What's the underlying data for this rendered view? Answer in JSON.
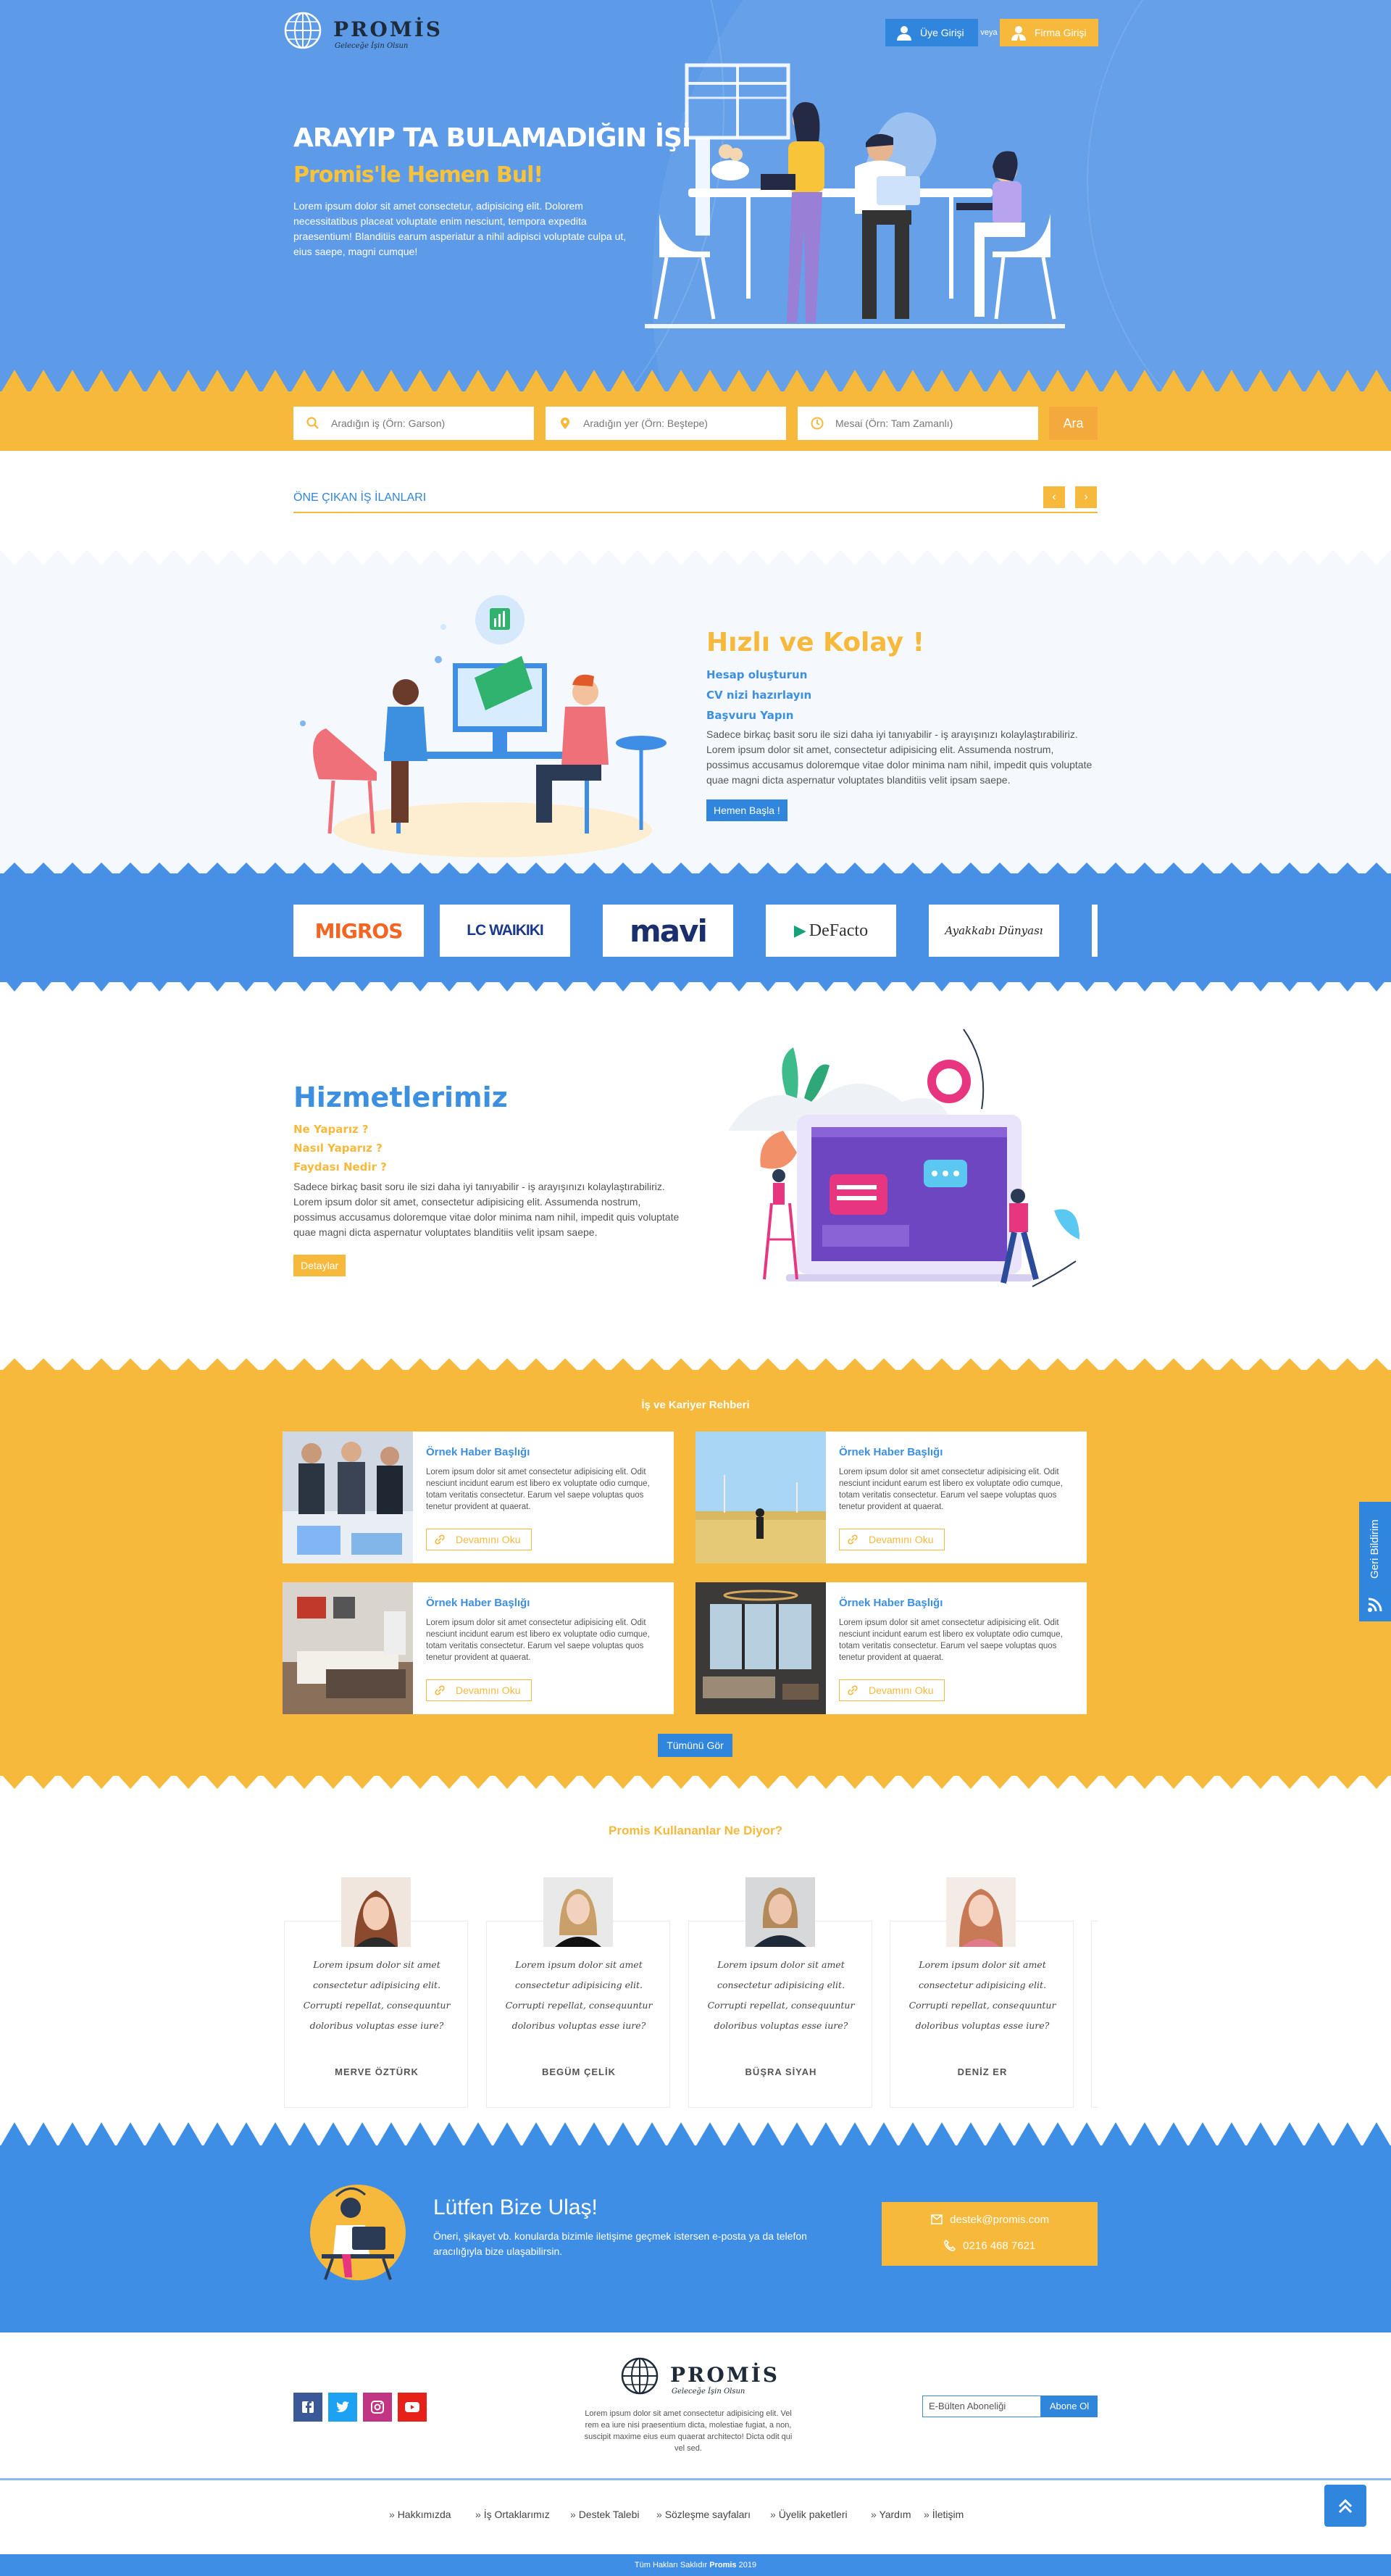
{
  "header": {
    "brand_name": "PROMİS",
    "brand_slogan": "Geleceğe İşin Olsun",
    "member_login": "Üye Girişi",
    "or_label": "veya",
    "company_login": "Firma Girişi"
  },
  "hero": {
    "title": "ARAYIP TA BULAMADIĞIN İŞİ",
    "subtitle": "Promis'le Hemen Bul!",
    "text": "Lorem ipsum dolor sit amet consectetur, adipisicing elit. Dolorem necessitatibus placeat voluptate enim nesciunt, tempora expedita praesentium! Blanditiis earum asperiatur a nihil adipisci voluptate culpa ut, eius saepe, magni cumque!"
  },
  "search": {
    "job_placeholder": "Aradığın iş (Örn: Garson)",
    "place_placeholder": "Aradığın yer (Örn: Beştepe)",
    "shift_placeholder": "Mesai (Örn: Tam Zamanlı)",
    "button": "Ara"
  },
  "featured": {
    "title": "ÖNE ÇIKAN İŞ İLANLARI",
    "prev": "‹",
    "next": "›"
  },
  "quick": {
    "title": "Hızlı ve Kolay !",
    "steps": [
      "Hesap oluşturun",
      "CV nizi hazırlayın",
      "Başvuru Yapın"
    ],
    "text": "Sadece birkaç basit soru ile sizi daha iyi tanıyabilir - iş arayışınızı kolaylaştırabiliriz. Lorem ipsum dolor sit amet, consectetur adipisicing elit. Assumenda nostrum, possimus accusamus doloremque vitae dolor minima nam nihil, impedit quis voluptate quae magni dicta aspernatur voluptates blanditiis velit ipsam saepe.",
    "button": "Hemen Başla !"
  },
  "brands": [
    "MIGROS",
    "LC WAIKIKI",
    "mavi",
    "DeFacto",
    "Ayakkabı Dünyası"
  ],
  "services": {
    "title": "Hizmetlerimiz",
    "items": [
      "Ne Yaparız ?",
      "Nasıl Yaparız ?",
      "Faydası Nedir ?"
    ],
    "text": "Sadece birkaç basit soru ile sizi daha iyi tanıyabilir - iş arayışınızı kolaylaştırabiliriz. Lorem ipsum dolor sit amet, consectetur adipisicing elit. Assumenda nostrum, possimus accusamus doloremque vitae dolor minima nam nihil, impedit quis voluptate quae magni dicta aspernatur voluptates blanditiis velit ipsam saepe.",
    "button": "Detaylar"
  },
  "guide": {
    "title": "İş ve Kariyer Rehberi",
    "cards": [
      {
        "title": "Örnek Haber Başlığı",
        "text": "Lorem ipsum dolor sit amet consectetur adipisicing elit. Odit nesciunt incidunt earum est libero ex voluptate odio cumque, totam veritatis consectetur. Earum vel saepe voluptas quos tenetur provident at quaerat.",
        "more": "Devamını Oku"
      },
      {
        "title": "Örnek Haber Başlığı",
        "text": "Lorem ipsum dolor sit amet consectetur adipisicing elit. Odit nesciunt incidunt earum est libero ex voluptate odio cumque, totam veritatis consectetur. Earum vel saepe voluptas quos tenetur provident at quaerat.",
        "more": "Devamını Oku"
      },
      {
        "title": "Örnek Haber Başlığı",
        "text": "Lorem ipsum dolor sit amet consectetur adipisicing elit. Odit nesciunt incidunt earum est libero ex voluptate odio cumque, totam veritatis consectetur. Earum vel saepe voluptas quos tenetur provident at quaerat.",
        "more": "Devamını Oku"
      },
      {
        "title": "Örnek Haber Başlığı",
        "text": "Lorem ipsum dolor sit amet consectetur adipisicing elit. Odit nesciunt incidunt earum est libero ex voluptate odio cumque, totam veritatis consectetur. Earum vel saepe voluptas quos tenetur provident at quaerat.",
        "more": "Devamını Oku"
      }
    ],
    "all_button": "Tümünü Gör"
  },
  "feedback_tab": "Geri Bildirim",
  "testimonials": {
    "title": "Promis Kullananlar Ne Diyor?",
    "items": [
      {
        "quote": "Lorem ipsum dolor sit amet consectetur adipisicing elit. Corrupti repellat, consequuntur doloribus voluptas esse iure?",
        "name": "MERVE ÖZTÜRK"
      },
      {
        "quote": "Lorem ipsum dolor sit amet consectetur adipisicing elit. Corrupti repellat, consequuntur doloribus voluptas esse iure?",
        "name": "BEGÜM ÇELİK"
      },
      {
        "quote": "Lorem ipsum dolor sit amet consectetur adipisicing elit. Corrupti repellat, consequuntur doloribus voluptas esse iure?",
        "name": "BÜŞRA SİYAH"
      },
      {
        "quote": "Lorem ipsum dolor sit amet consectetur adipisicing elit. Corrupti repellat, consequuntur doloribus voluptas esse iure?",
        "name": "DENİZ ER"
      }
    ]
  },
  "contact": {
    "title": "Lütfen Bize Ulaş!",
    "text": "Öneri, şikayet vb. konularda bizimle iletişime geçmek istersen e-posta ya da telefon aracılığıyla bize ulaşabilirsin.",
    "email": "destek@promis.com",
    "phone": "0216 468 7621"
  },
  "footer": {
    "about": "Lorem ipsum dolor sit amet consectetur adipisicing elit. Vel rem ea iure nisi praesentium dicta, molestiae fugiat, a non, suscipit maxime eius eum quaerat architecto! Dicta odit qui vel sed.",
    "newsletter_placeholder": "E-Bülten Aboneliği",
    "subscribe": "Abone Ol",
    "links": [
      "Hakkımızda",
      "İş Ortaklarımız",
      "Destek Talebi",
      "Sözleşme sayfaları",
      "Üyelik paketleri",
      "Yardım",
      "İletişim"
    ],
    "copyright_prefix": "Tüm Hakları Saklıdır",
    "copyright_brand": "Promis",
    "copyright_year": "2019"
  },
  "colors": {
    "blue": "#3f8ee6",
    "orange": "#f6b93b",
    "hero": "#5d9be8"
  }
}
